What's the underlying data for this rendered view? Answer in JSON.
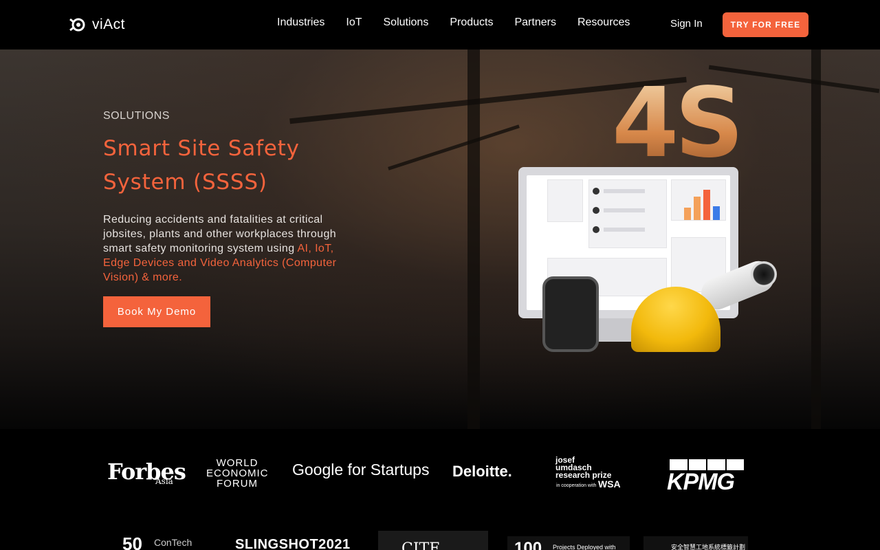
{
  "header": {
    "logo_text": "viAct",
    "nav": [
      "Industries",
      "IoT",
      "Solutions",
      "Products",
      "Partners",
      "Resources"
    ],
    "sign_in": "Sign In",
    "cta": "TRY FOR FREE"
  },
  "hero": {
    "kicker": "SOLUTIONS",
    "title_line1": "Smart Site Safety",
    "title_line2": "System (SSSS)",
    "desc_plain": "Reducing accidents and fatalities at critical jobsites, plants and other workplaces through smart safety monitoring system using ",
    "desc_highlight": "AI, IoT, Edge Devices and Video Analytics (Computer Vision) & more.",
    "button": "Book My Demo",
    "graphic_text": "4S"
  },
  "logos": {
    "forbes": "Forbes",
    "forbes_sub": "Asia",
    "wef_line1": "WORLD",
    "wef_line2": "ECONOMIC",
    "wef_line3": "FORUM",
    "google": "Google for Startups",
    "deloitte": "Deloitte.",
    "josef_line1": "josef",
    "josef_line2": "umdasch",
    "josef_line3": "research prize",
    "josef_sub": "in cooperation with",
    "wsa": "WSA",
    "kpmg": "KPMG",
    "top50": "50",
    "contech": "ConTech",
    "slingshot": "SLINGSHOT2021",
    "cite": "CITE",
    "projects_num": "100",
    "projects_txt": "Projects Deployed with",
    "cn": "安全智慧工地系統標籤計劃"
  },
  "colors": {
    "accent": "#f4633c",
    "background": "#000000"
  }
}
